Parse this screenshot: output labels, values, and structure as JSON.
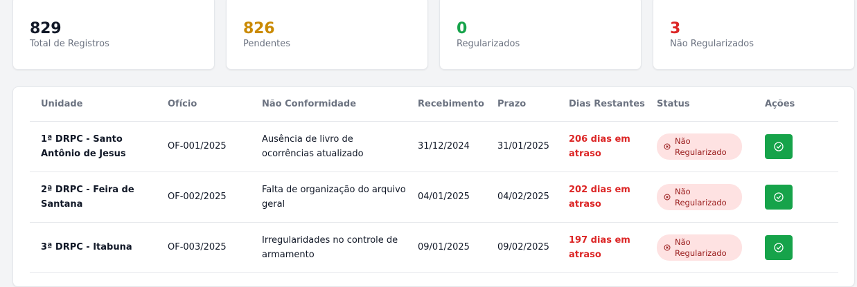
{
  "stats": [
    {
      "value": "829",
      "label": "Total de Registros"
    },
    {
      "value": "826",
      "label": "Pendentes"
    },
    {
      "value": "0",
      "label": "Regularizados"
    },
    {
      "value": "3",
      "label": "Não Regularizados"
    }
  ],
  "table": {
    "headers": [
      "Unidade",
      "Ofício",
      "Não Conformidade",
      "Recebimento",
      "Prazo",
      "Dias Restantes",
      "Status",
      "Ações"
    ],
    "rows": [
      {
        "unidade": "1ª DRPC - Santo Antônio de Jesus",
        "oficio": "OF-001/2025",
        "nc": "Ausência de livro de ocorrências atualizado",
        "recebimento": "31/12/2024",
        "prazo": "31/01/2025",
        "dias": "206 dias em atraso",
        "status": "Não Regularizado",
        "action_icon": "check-circle-icon"
      },
      {
        "unidade": "2ª DRPC - Feira de Santana",
        "oficio": "OF-002/2025",
        "nc": "Falta de organização do arquivo geral",
        "recebimento": "04/01/2025",
        "prazo": "04/02/2025",
        "dias": "202 dias em atraso",
        "status": "Não Regularizado",
        "action_icon": "check-circle-icon"
      },
      {
        "unidade": "3ª DRPC - Itabuna",
        "oficio": "OF-003/2025",
        "nc": "Irregularidades no controle de armamento",
        "recebimento": "09/01/2025",
        "prazo": "09/02/2025",
        "dias": "197 dias em atraso",
        "status": "Não Regularizado",
        "action_icon": "check-circle-icon"
      }
    ]
  },
  "colors": {
    "total": "#111827",
    "pending": "#ca8a04",
    "regularized": "#16a34a",
    "not_regularized": "#dc2626",
    "action": "#16a34a"
  }
}
